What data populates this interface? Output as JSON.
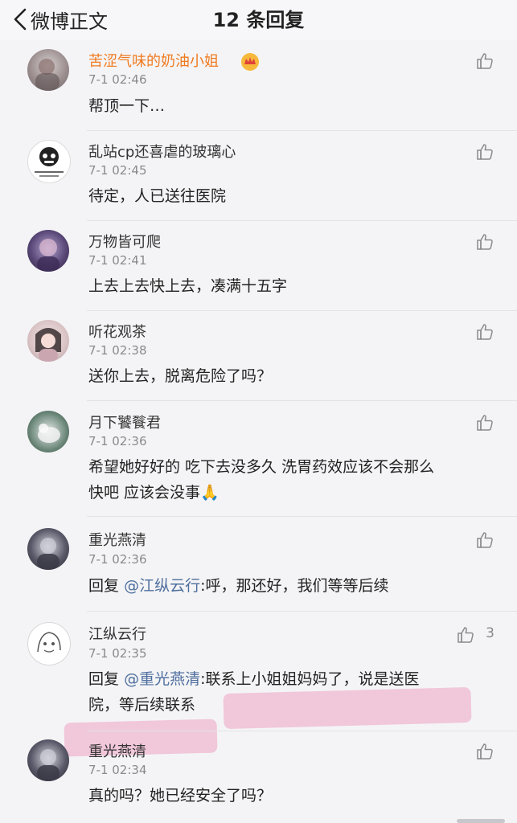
{
  "header": {
    "back_label": "微博正文",
    "title": "12 条回复"
  },
  "comments": [
    {
      "name": "苦涩气味的奶油小姐",
      "time": "7-1 02:46",
      "text": "帮顶一下…",
      "vip": true
    },
    {
      "name": "乱站cp还喜虐的玻璃心",
      "time": "7-1 02:45",
      "text": "待定，人已送往医院"
    },
    {
      "name": "万物皆可爬",
      "time": "7-1 02:41",
      "text": "上去上去快上去，凑满十五字"
    },
    {
      "name": "听花观茶",
      "time": "7-1 02:38",
      "text": "送你上去，脱离危险了吗？"
    },
    {
      "name": "月下饕餮君",
      "time": "7-1 02:36",
      "text_line1": "希望她好好的 吃下去没多久 洗胃药效应该不会那么",
      "text_line2": "快吧 应该会没事",
      "emoji": "🙏"
    },
    {
      "name": "重光燕清",
      "time": "7-1 02:36",
      "reply_prefix": "回复",
      "mention": "@江纵云行",
      "text": ":呼，那还好，我们等等后续"
    },
    {
      "name": "江纵云行",
      "time": "7-1 02:35",
      "reply_prefix": "回复",
      "mention": "@重光燕清",
      "text_line1": ":联系上小姐姐妈妈了，说是送医",
      "text_line2": "院，等后续联系",
      "likes": "3"
    },
    {
      "name": "重光燕清",
      "time": "7-1 02:34",
      "text": "真的吗？她已经安全了吗？"
    }
  ],
  "colors": {
    "vip_name": "#f07a1f",
    "mention": "#4e6e9e",
    "highlight": "#efa2c2"
  }
}
